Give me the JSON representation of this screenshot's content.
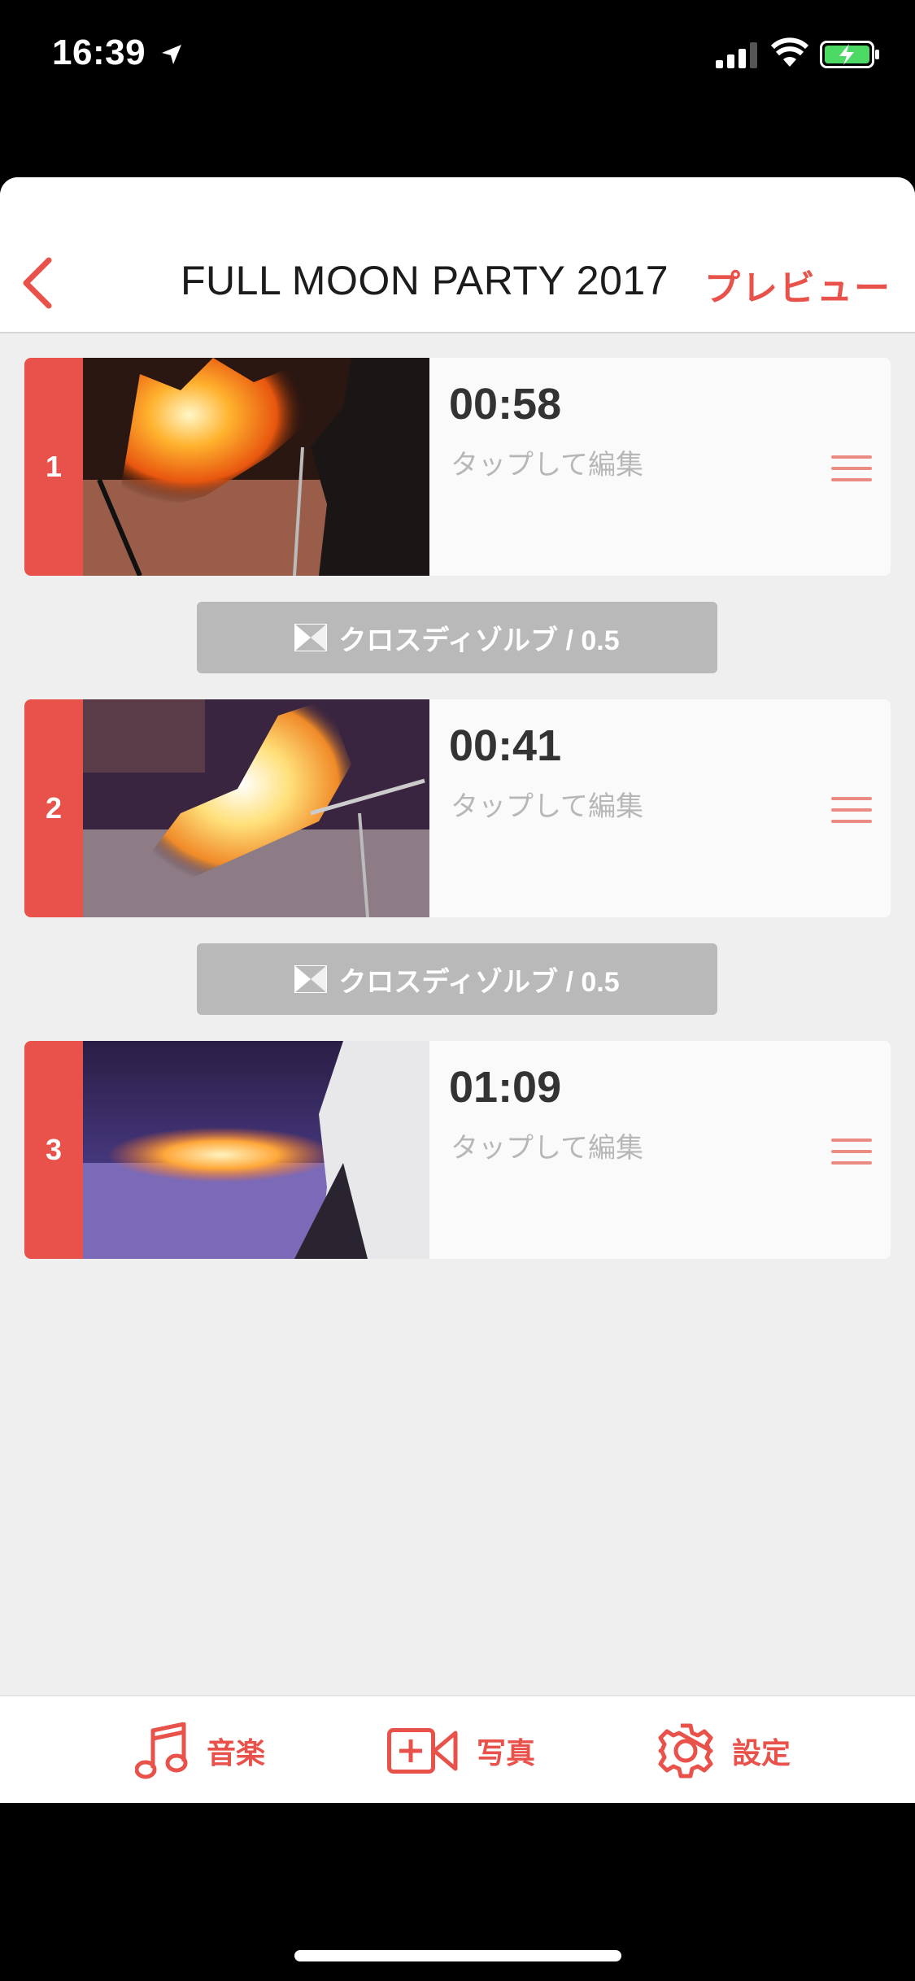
{
  "status": {
    "time": "16:39"
  },
  "nav": {
    "title": "FULL MOON PARTY 2017",
    "preview_label": "プレビュー"
  },
  "clips": [
    {
      "index": "1",
      "duration": "00:58",
      "edit_hint": "タップして編集"
    },
    {
      "index": "2",
      "duration": "00:41",
      "edit_hint": "タップして編集"
    },
    {
      "index": "3",
      "duration": "01:09",
      "edit_hint": "タップして編集"
    }
  ],
  "transitions": [
    {
      "label": "クロスディゾルブ / 0.5"
    },
    {
      "label": "クロスディゾルブ / 0.5"
    }
  ],
  "toolbar": {
    "music_label": "音楽",
    "photo_label": "写真",
    "settings_label": "設定"
  },
  "colors": {
    "accent": "#e8524a",
    "background": "#efefef",
    "transition": "#b9b9b9"
  },
  "icons": [
    "location-arrow-icon",
    "signal-icon",
    "wifi-icon",
    "battery-charging-icon",
    "back-chevron-icon",
    "drag-handle-icon",
    "crossfade-icon",
    "music-note-icon",
    "add-video-icon",
    "gear-icon"
  ]
}
